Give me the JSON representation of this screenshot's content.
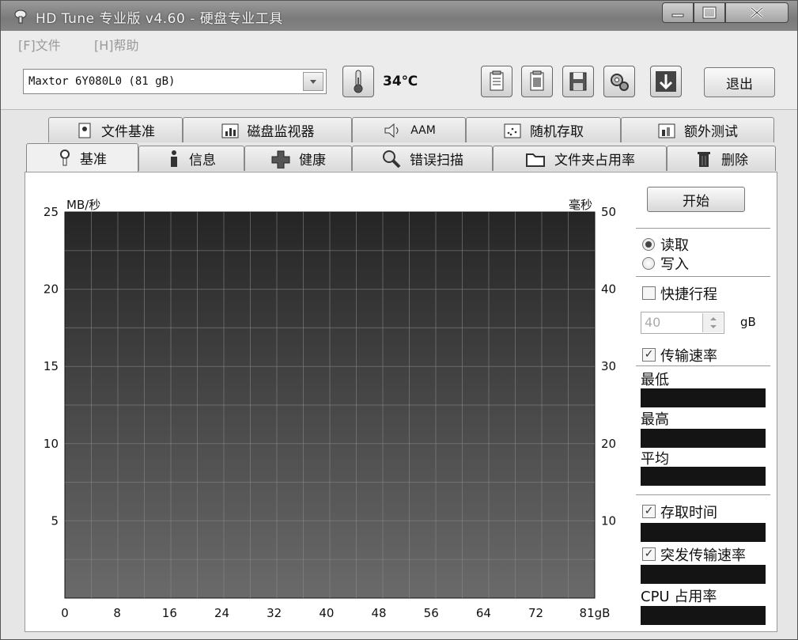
{
  "window": {
    "title": "HD Tune 专业版 v4.60 - 硬盘专业工具"
  },
  "menu": {
    "file": "[F]文件",
    "help": "[H]帮助"
  },
  "toolbar": {
    "drive": "Maxtor 6Y080L0 (81 gB)",
    "temperature": "34℃",
    "exit_label": "退出",
    "icons": [
      "copy-info-icon",
      "copy-screenshot-icon",
      "save-icon",
      "options-icon",
      "download-icon"
    ]
  },
  "tabs": {
    "row1": [
      {
        "label": "文件基准",
        "icon": "file-benchmark-icon"
      },
      {
        "label": "磁盘监视器",
        "icon": "disk-monitor-icon"
      },
      {
        "label": "AAM",
        "icon": "speaker-icon"
      },
      {
        "label": "随机存取",
        "icon": "random-access-icon"
      },
      {
        "label": "额外测试",
        "icon": "extra-tests-icon"
      }
    ],
    "row2": [
      {
        "label": "基准",
        "icon": "benchmark-icon",
        "active": true
      },
      {
        "label": "信息",
        "icon": "info-icon"
      },
      {
        "label": "健康",
        "icon": "health-icon"
      },
      {
        "label": "错误扫描",
        "icon": "magnifier-icon"
      },
      {
        "label": "文件夹占用率",
        "icon": "folder-icon"
      },
      {
        "label": "删除",
        "icon": "trash-icon"
      }
    ]
  },
  "chart_data": {
    "type": "line",
    "ylabel_left": "MB/秒",
    "ylabel_right": "毫秒",
    "x_ticks": [
      "0",
      "8",
      "16",
      "24",
      "32",
      "40",
      "48",
      "56",
      "64",
      "72",
      "81gB"
    ],
    "y_left_ticks": [
      "5",
      "10",
      "15",
      "20",
      "25"
    ],
    "y_right_ticks": [
      "10",
      "20",
      "30",
      "40",
      "50"
    ],
    "ylim_left": [
      0,
      25
    ],
    "ylim_right": [
      0,
      50
    ],
    "xlim": [
      0,
      81
    ],
    "grid": true,
    "series": []
  },
  "controls": {
    "start_label": "开始",
    "read_label": "读取",
    "write_label": "写入",
    "read_selected": true,
    "short_stroke_label": "快捷行程",
    "short_stroke_checked": false,
    "short_stroke_value": "40",
    "short_stroke_unit": "gB",
    "transfer_rate_label": "传输速率",
    "transfer_rate_checked": true,
    "min_label": "最低",
    "max_label": "最高",
    "avg_label": "平均",
    "access_time_label": "存取时间",
    "access_time_checked": true,
    "burst_rate_label": "突发传输速率",
    "burst_rate_checked": true,
    "cpu_label": "CPU 占用率"
  }
}
